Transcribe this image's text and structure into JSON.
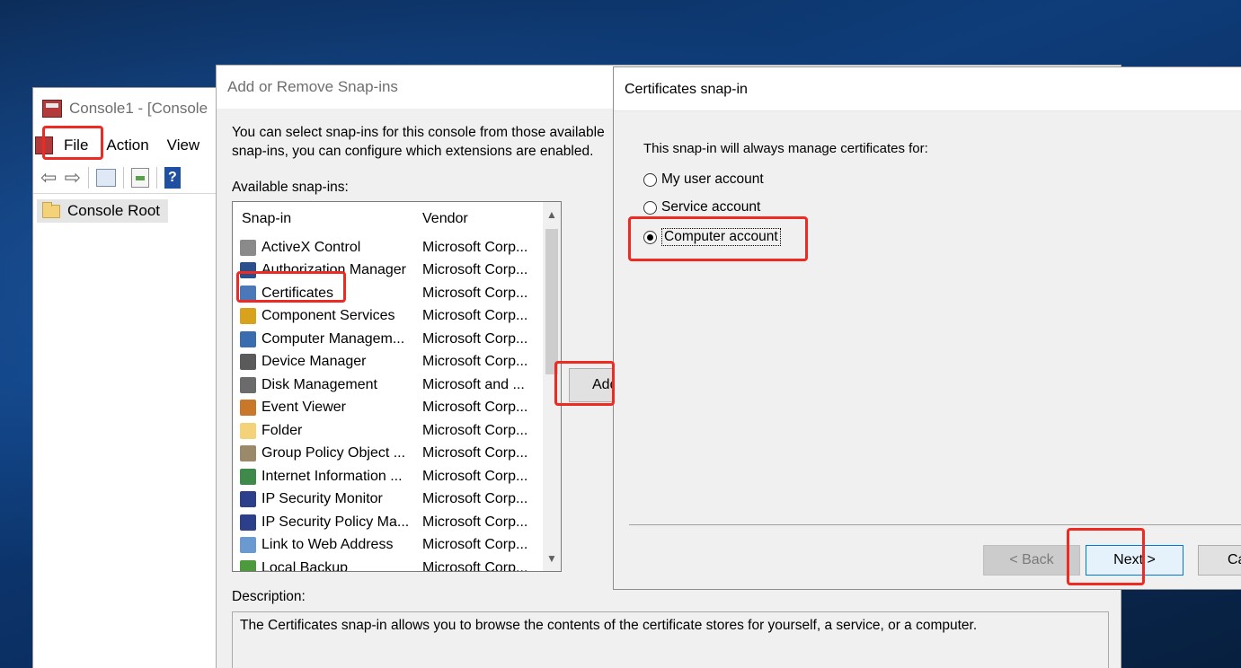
{
  "console": {
    "title": "Console1 - [Console",
    "menu": [
      "File",
      "Action",
      "View"
    ],
    "tree_root": "Console Root"
  },
  "snapins_dialog": {
    "title": "Add or Remove Snap-ins",
    "intro_line1": "You can select snap-ins for this console from those available",
    "intro_line2": "snap-ins, you can configure which extensions are enabled.",
    "available_label": "Available snap-ins:",
    "columns": {
      "name": "Snap-in",
      "vendor": "Vendor"
    },
    "rows": [
      {
        "name": "ActiveX Control",
        "vendor": "Microsoft Corp...",
        "icon": "activex-icon",
        "color": "#8a8a8a"
      },
      {
        "name": "Authorization Manager",
        "vendor": "Microsoft Corp...",
        "icon": "authorization-manager-icon",
        "color": "#2b4f8a"
      },
      {
        "name": "Certificates",
        "vendor": "Microsoft Corp...",
        "icon": "certificates-icon",
        "color": "#4a78b8"
      },
      {
        "name": "Component Services",
        "vendor": "Microsoft Corp...",
        "icon": "component-services-icon",
        "color": "#d8a21c"
      },
      {
        "name": "Computer Managem...",
        "vendor": "Microsoft Corp...",
        "icon": "computer-management-icon",
        "color": "#3a6db0"
      },
      {
        "name": "Device Manager",
        "vendor": "Microsoft Corp...",
        "icon": "device-manager-icon",
        "color": "#5a5a5a"
      },
      {
        "name": "Disk Management",
        "vendor": "Microsoft and ...",
        "icon": "disk-management-icon",
        "color": "#6b6b6b"
      },
      {
        "name": "Event Viewer",
        "vendor": "Microsoft Corp...",
        "icon": "event-viewer-icon",
        "color": "#c9782a"
      },
      {
        "name": "Folder",
        "vendor": "Microsoft Corp...",
        "icon": "folder-icon",
        "color": "#f3d27a"
      },
      {
        "name": "Group Policy Object ...",
        "vendor": "Microsoft Corp...",
        "icon": "group-policy-icon",
        "color": "#9a8a6a"
      },
      {
        "name": "Internet Information ...",
        "vendor": "Microsoft Corp...",
        "icon": "iis-icon",
        "color": "#3f8a4a"
      },
      {
        "name": "IP Security Monitor",
        "vendor": "Microsoft Corp...",
        "icon": "ip-security-monitor-icon",
        "color": "#2c3f8a"
      },
      {
        "name": "IP Security Policy Ma...",
        "vendor": "Microsoft Corp...",
        "icon": "ip-security-policy-icon",
        "color": "#2c3f8a"
      },
      {
        "name": "Link to Web Address",
        "vendor": "Microsoft Corp...",
        "icon": "web-link-icon",
        "color": "#6a9ad0"
      },
      {
        "name": "Local Backup",
        "vendor": "Microsoft Corp...",
        "icon": "local-backup-icon",
        "color": "#4c9a3c"
      }
    ],
    "add_button": "Add",
    "description_label": "Description:",
    "description_text": "The Certificates snap-in allows you to browse the contents of the certificate stores for yourself, a service, or a computer."
  },
  "cert_dialog": {
    "title": "Certificates snap-in",
    "prompt": "This snap-in will always manage certificates for:",
    "options": [
      {
        "label": "My user account",
        "checked": false
      },
      {
        "label": "Service account",
        "checked": false
      },
      {
        "label": "Computer account",
        "checked": true
      }
    ],
    "back_button": "< Back",
    "next_button": "Next >",
    "cancel_button": "Ca"
  },
  "annotation_color": "#ee2a22"
}
